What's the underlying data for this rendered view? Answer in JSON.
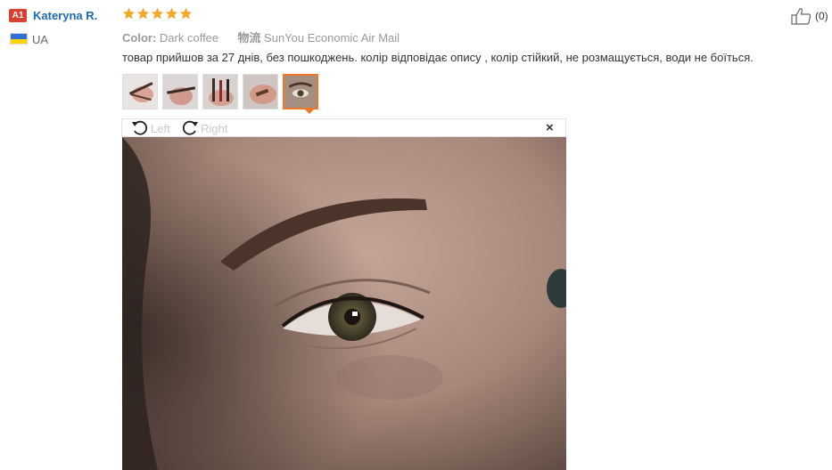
{
  "reviewer": {
    "level_badge": "A1",
    "name": "Kateryna R.",
    "country": "UA",
    "flag_colors": [
      "#2f6fd6",
      "#ffd500"
    ]
  },
  "rating": {
    "stars": 5,
    "max": 5,
    "star_color": "#f5a623"
  },
  "meta": {
    "color_label": "Color:",
    "color_value": "Dark coffee",
    "logistics_label": "物流",
    "logistics_value": "SunYou Economic Air Mail"
  },
  "review_text": "товар прийшов за 27 днів, без пошкоджень. колір відповідає опису , колір стійкий, не розмащується, води не боїться.",
  "thumbnails": [
    {
      "icon": "hand-with-pencil-photo"
    },
    {
      "icon": "hand-with-pencil-photo"
    },
    {
      "icon": "hand-with-pencils-photo"
    },
    {
      "icon": "hand-swatch-photo"
    },
    {
      "icon": "eye-closeup-photo",
      "active": true
    }
  ],
  "viewer": {
    "rotate_left": "Left",
    "rotate_right": "Right",
    "close_icon": "×"
  },
  "helpful": {
    "count": "(0)"
  },
  "colors": {
    "name_link": "#1a6bb5",
    "badge": "#d8412f",
    "active_thumb": "#f0782a"
  }
}
